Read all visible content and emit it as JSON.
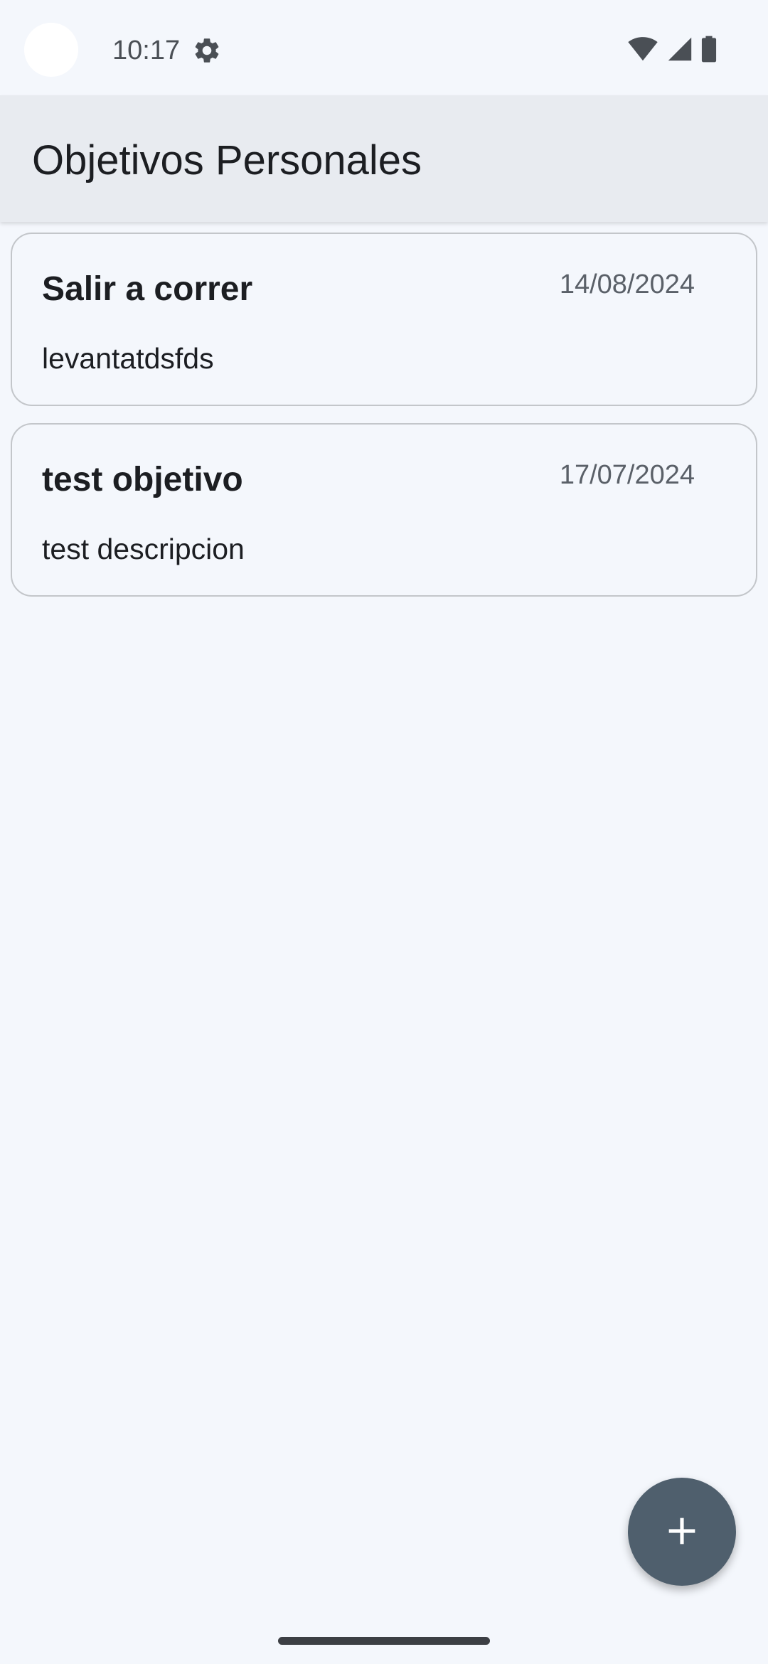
{
  "status_bar": {
    "time": "10:17",
    "icons": [
      "settings-gear-icon",
      "wifi-icon",
      "cell-signal-icon",
      "battery-icon"
    ]
  },
  "app_bar": {
    "title": "Objetivos Personales"
  },
  "goals": [
    {
      "title": "Salir a correr",
      "date": "14/08/2024",
      "description": "levantatdsfds"
    },
    {
      "title": "test objetivo",
      "date": "17/07/2024",
      "description": "test descripcion"
    }
  ],
  "fab": {
    "icon": "plus-icon"
  },
  "colors": {
    "background": "#f4f7fc",
    "app_bar": "#e8ebf0",
    "card_border": "#c3c6ca",
    "fab": "#4f5f6d",
    "text_primary": "#1c1e22",
    "text_secondary": "#5a6068"
  }
}
